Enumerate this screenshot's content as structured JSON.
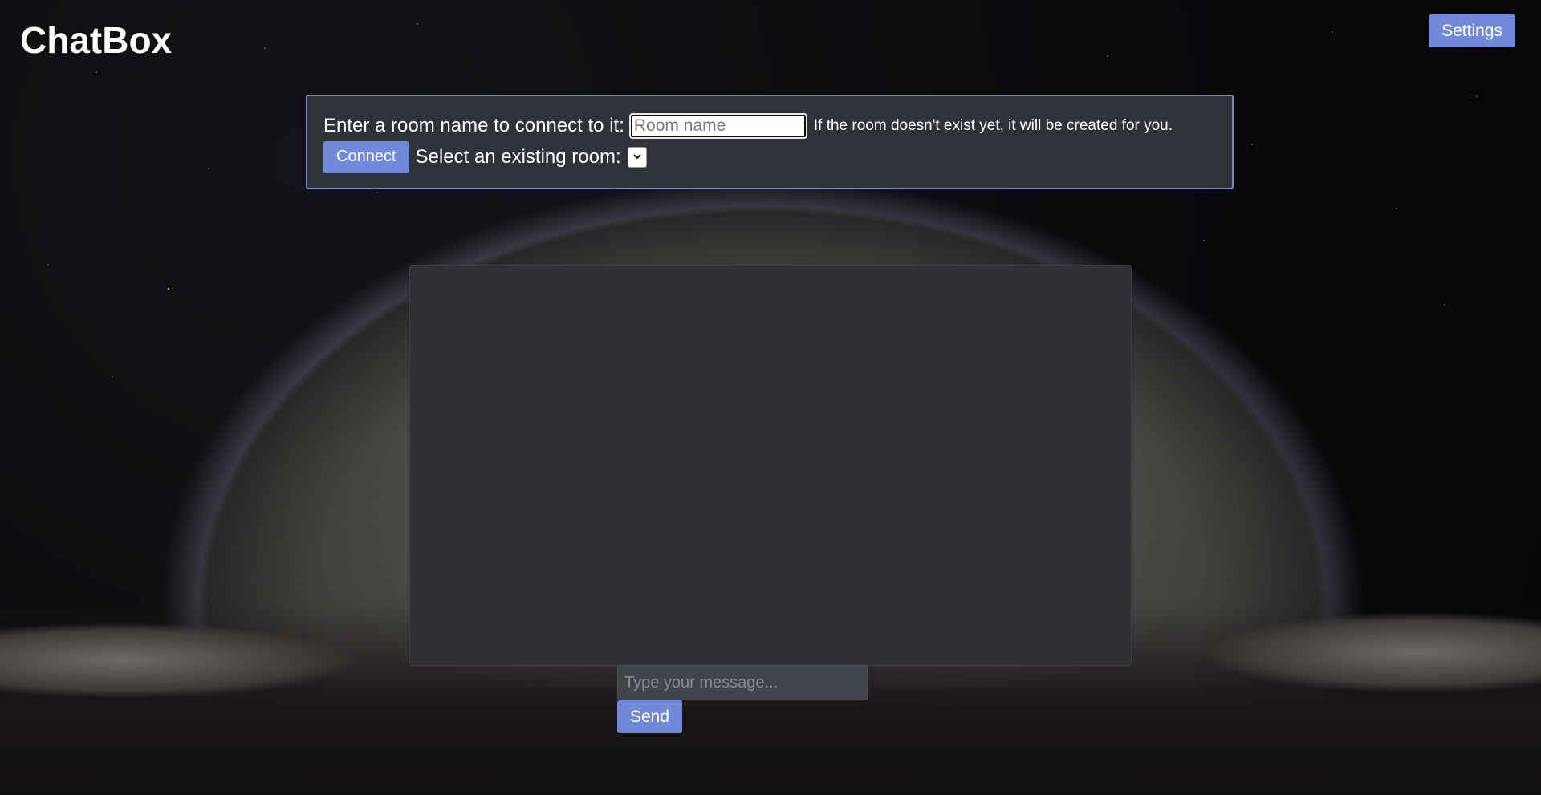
{
  "header": {
    "title": "ChatBox",
    "settings_label": "Settings"
  },
  "room": {
    "prompt_label": "Enter a room name to connect to it:",
    "input_value": "",
    "input_placeholder": "Room name",
    "hint": "If the room doesn't exist yet, it will be created for you.",
    "connect_label": "Connect",
    "select_label": "Select an existing room:",
    "select_value": ""
  },
  "chat": {
    "messages": []
  },
  "composer": {
    "placeholder": "Type your message...",
    "value": "",
    "send_label": "Send"
  },
  "colors": {
    "accent": "#7289da",
    "panel": "#2f3238",
    "chat_bg": "#2f3136",
    "input_bg": "#40444b"
  },
  "icons": {
    "select_arrow": "chevron-down-icon"
  }
}
